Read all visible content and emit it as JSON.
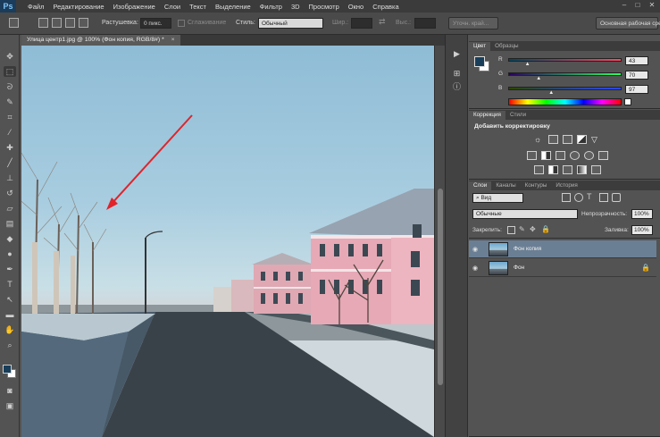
{
  "app": {
    "logo": "Ps"
  },
  "menu": [
    "Файл",
    "Редактирование",
    "Изображение",
    "Слои",
    "Текст",
    "Выделение",
    "Фильтр",
    "3D",
    "Просмотр",
    "Окно",
    "Справка"
  ],
  "window_controls": {
    "minimize": "–",
    "restore": "□",
    "close": "✕"
  },
  "options": {
    "feather_label": "Растушевка:",
    "feather_value": "0 пикс.",
    "antialias_label": "Сглаживание",
    "style_label": "Стиль:",
    "style_value": "Обычный",
    "width_label": "Шир.:",
    "height_label": "Выс.:",
    "refine_edge_button": "Уточн. край...",
    "workspace_button": "Основная рабочая среда"
  },
  "document": {
    "tab_title": "Улица центр1.jpg @ 100% (Фон копия, RGB/8#) *",
    "close": "×"
  },
  "colors": {
    "foreground": "#183e5a",
    "background": "#ffffff",
    "menubar": "#3b3b3b",
    "panel": "#535353",
    "arrow_annotation": "#e0242a"
  },
  "tools": [
    "move-icon",
    "marquee-icon",
    "lasso-icon",
    "quick-select-icon",
    "crop-icon",
    "eyedropper-icon",
    "healing-icon",
    "brush-icon",
    "stamp-icon",
    "history-brush-icon",
    "eraser-icon",
    "gradient-icon",
    "blur-icon",
    "dodge-icon",
    "pen-icon",
    "type-icon",
    "path-select-icon",
    "rectangle-icon",
    "hand-icon",
    "zoom-icon"
  ],
  "color_panel": {
    "tabs": [
      "Цвет",
      "Образцы"
    ],
    "sliders": [
      {
        "label": "R",
        "value": "43",
        "fraction": 0.17
      },
      {
        "label": "G",
        "value": "70",
        "fraction": 0.27
      },
      {
        "label": "B",
        "value": "97",
        "fraction": 0.38
      }
    ]
  },
  "adjustments_panel": {
    "tabs": [
      "Коррекция",
      "Стили"
    ],
    "heading": "Добавить корректировку"
  },
  "layers_panel": {
    "tabs": [
      "Слои",
      "Каналы",
      "Контуры",
      "История"
    ],
    "filter_kind": "Вид",
    "blend_mode": "Обычные",
    "opacity_label": "Непрозрачность:",
    "opacity_value": "100%",
    "lock_label": "Закрепить:",
    "fill_label": "Заливка:",
    "fill_value": "100%",
    "layers": [
      {
        "name": "Фон копия",
        "selected": true,
        "locked": false
      },
      {
        "name": "Фон",
        "selected": false,
        "locked": true
      }
    ]
  }
}
